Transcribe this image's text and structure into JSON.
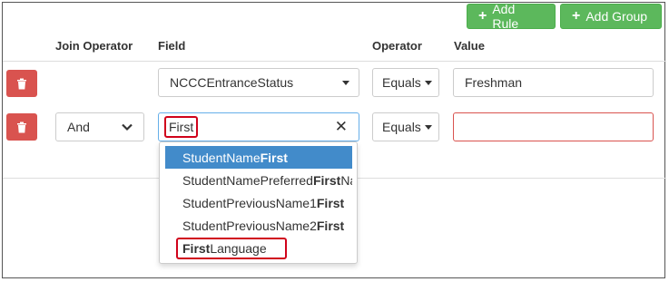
{
  "toolbar": {
    "add_rule_label": "Add Rule",
    "add_group_label": "Add Group"
  },
  "headers": {
    "join_operator": "Join Operator",
    "field": "Field",
    "operator": "Operator",
    "value": "Value"
  },
  "rows": [
    {
      "field_value": "NCCCEntranceStatus",
      "operator_value": "Equals",
      "value_text": "Freshman"
    },
    {
      "join_value": "And",
      "field_search_value": "First",
      "operator_value": "Equals",
      "value_text": ""
    }
  ],
  "dropdown": {
    "options": [
      {
        "prefix": "StudentName",
        "match": "First",
        "suffix": ""
      },
      {
        "prefix": "StudentNamePreferred",
        "match": "First",
        "suffix": "Na"
      },
      {
        "prefix": "StudentPreviousName1",
        "match": "First",
        "suffix": ""
      },
      {
        "prefix": "StudentPreviousName2",
        "match": "First",
        "suffix": ""
      },
      {
        "prefix": "",
        "match": "First",
        "suffix": "Language"
      }
    ]
  },
  "colors": {
    "green": "#5cb85c",
    "danger": "#d9534f",
    "highlight": "#d0021b",
    "active": "#428bca"
  },
  "icons": {
    "add": "plus-icon",
    "delete": "trash-icon",
    "clear": "close-icon",
    "dropdown": "chevron-down-icon"
  }
}
